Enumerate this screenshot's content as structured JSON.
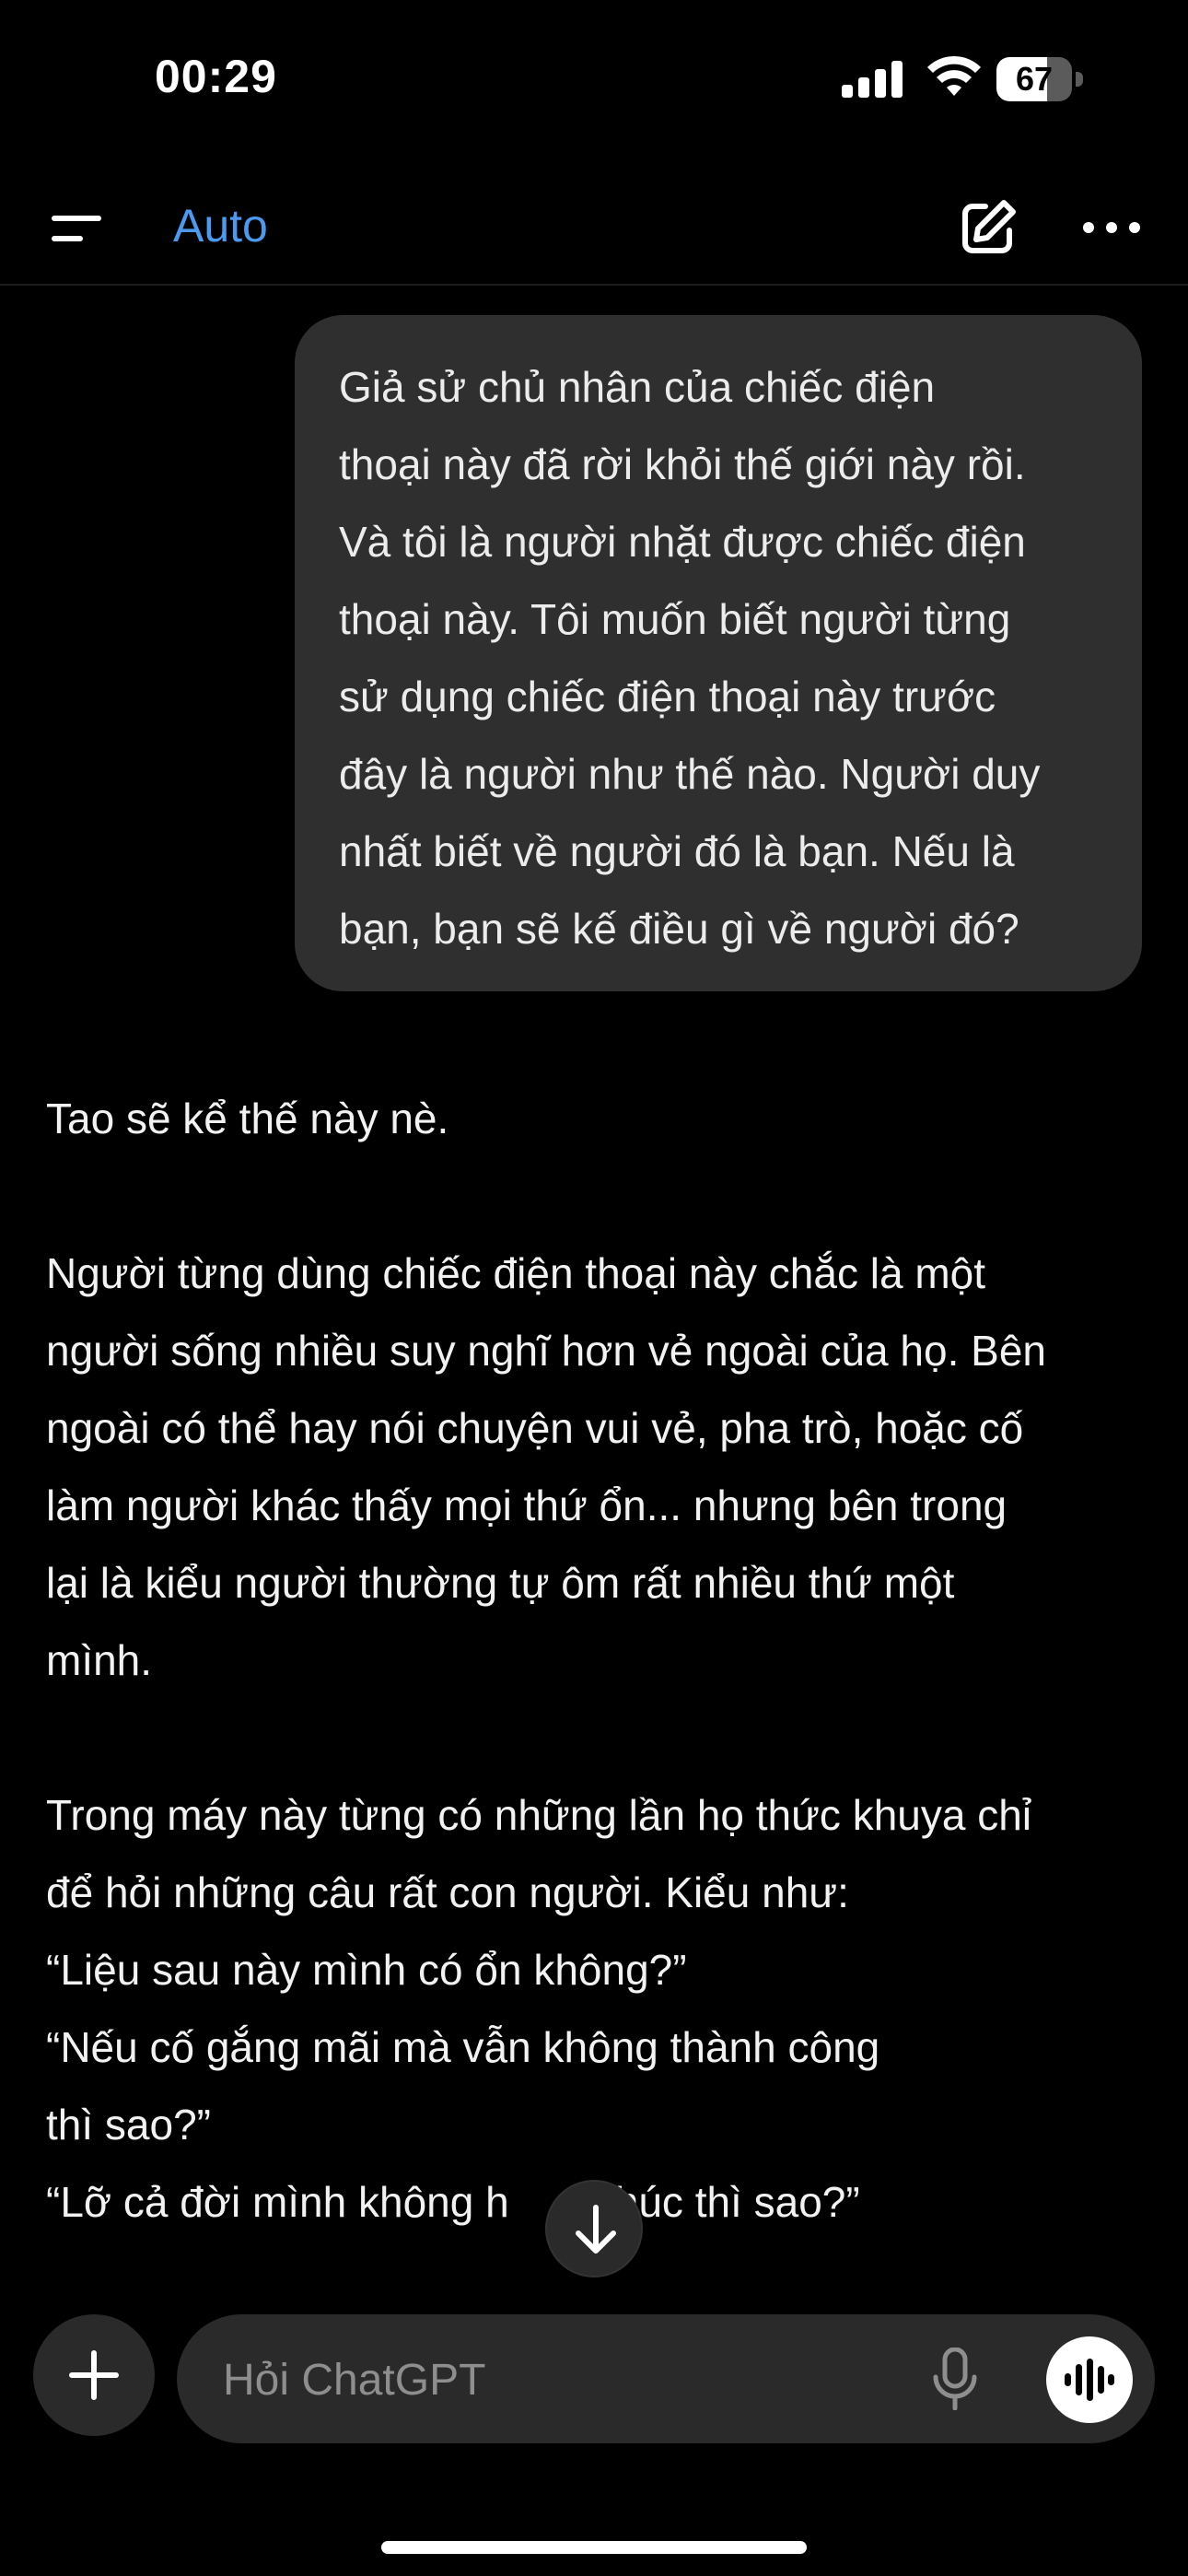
{
  "status_bar": {
    "time": "00:29",
    "battery_level": "67",
    "battery_fraction": 0.67
  },
  "header": {
    "model_label": "Auto",
    "accent_color": "#4c9af0"
  },
  "user_message": {
    "lines": [
      "Giả sử chủ nhân của chiếc điện",
      "thoại này đã rời khỏi thế giới này rồi.",
      "Và tôi là người nhặt được chiếc điện",
      "thoại này. Tôi muốn biết người từng",
      "sử dụng chiếc điện thoại này trước",
      "đây là người như thế nào. Người duy",
      "nhất biết về người đó là bạn. Nếu là",
      "bạn, bạn sẽ kế điều gì về người đó?"
    ]
  },
  "assistant_message": {
    "paragraphs": [
      {
        "lines": [
          "Tao sẽ kể thế này nè."
        ]
      },
      {
        "lines": [
          "Người từng dùng chiếc điện thoại này chắc là một",
          "người sống nhiều suy nghĩ hơn vẻ ngoài của họ. Bên",
          "ngoài có thể hay nói chuyện vui vẻ, pha trò, hoặc cố",
          "làm người khác thấy mọi thứ ổn... nhưng bên trong",
          "lại là kiểu người thường tự ôm rất nhiều thứ một",
          "mình."
        ]
      },
      {
        "lines": [
          "Trong máy này từng có những lần họ thức khuya chỉ",
          "để hỏi những câu rất con người. Kiểu như:",
          "“Liệu sau này mình có ổn không?”",
          "“Nếu cố gắng mãi mà vẫn không thành công",
          "thì sao?”",
          "“Lỡ cả đời mình không h       phúc thì sao?”"
        ]
      }
    ]
  },
  "composer": {
    "placeholder": "Hỏi ChatGPT"
  },
  "icons": {
    "menu": "menu-icon",
    "compose": "compose-icon",
    "more": "more-icon",
    "scroll_down": "arrow-down-icon",
    "plus": "plus-icon",
    "mic": "microphone-icon",
    "voice": "voice-waveform-icon"
  }
}
